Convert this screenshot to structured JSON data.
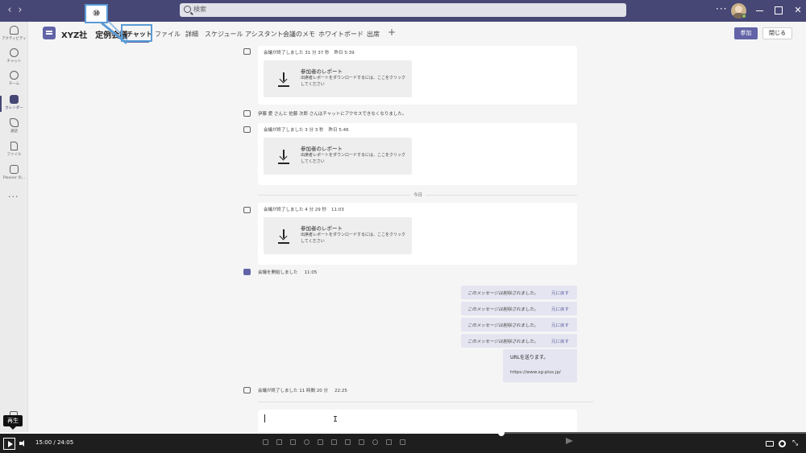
{
  "titlebar": {
    "back_icon": "‹",
    "forward_icon": "›",
    "search_placeholder": "検索",
    "more_icon": "···",
    "close_icon": "✕"
  },
  "rail": {
    "items": [
      {
        "label": "アクティビティ",
        "icon": "bell-icon"
      },
      {
        "label": "チャット",
        "icon": "chat-icon"
      },
      {
        "label": "チーム",
        "icon": "teams-icon"
      },
      {
        "label": "カレンダー",
        "icon": "calendar-icon"
      },
      {
        "label": "通話",
        "icon": "phone-icon"
      },
      {
        "label": "ファイル",
        "icon": "file-icon"
      },
      {
        "label": "Planner の...",
        "icon": "planner-icon"
      }
    ],
    "more": "···"
  },
  "header": {
    "title": "XYZ社　定例会議",
    "tabs": [
      "チャット",
      "ファイル",
      "詳細",
      "スケジュール アシスタント",
      "会議のメモ",
      "ホワイトボード",
      "出席"
    ],
    "add_tab": "+",
    "join_label": "参加",
    "close_label": "閉じる"
  },
  "callout": {
    "number": "⑩"
  },
  "chat": {
    "events": [
      {
        "header": "会議が終了しました  31 分 37 秒",
        "time": "昨日 5:39",
        "report_title": "参加者のレポート",
        "report_desc": "出席者レポートをダウンロードするには、ここをクリックしてください"
      },
      {
        "header": "会議が終了しました  3 分 3 秒",
        "time": "昨日 5:46",
        "report_title": "参加者のレポート",
        "report_desc": "出席者レポートをダウンロードするには、ここをクリックしてください"
      },
      {
        "header": "会議が終了しました  4 分 29 秒",
        "time": "11:03",
        "report_title": "参加者のレポート",
        "report_desc": "出席者レポートをダウンロードするには、ここをクリックしてください"
      }
    ],
    "access_notice": "伊藤 愛 さんと 佐藤 次郎 さんはチャットにアクセスできなくなりました。",
    "day_label": "今日",
    "meeting_started": "会議を開始しました",
    "meeting_started_time": "11:05",
    "deleted_messages": [
      {
        "text": "このメッセージは削除されました。",
        "undo": "元に戻す"
      },
      {
        "text": "このメッセージは削除されました。",
        "undo": "元に戻す"
      },
      {
        "text": "このメッセージは削除されました。",
        "undo": "元に戻す"
      },
      {
        "text": "このメッセージは削除されました。",
        "undo": "元に戻す"
      }
    ],
    "url_message": {
      "line1": "URLを送ります。",
      "line2": "https://www.sg-plus.jp/"
    },
    "meeting_ended_last": "会議が終了しました  11 時間 20 分",
    "meeting_ended_last_time": "22:25",
    "compose_ibeam": "I"
  },
  "player": {
    "tooltip": "再生",
    "time": "15:00  /  24:05",
    "progress": 0.622,
    "minimize_icon": "⤡"
  },
  "colors": {
    "titlebar": "#464775",
    "accent": "#6264a7",
    "callout": "#5b9bd5"
  }
}
